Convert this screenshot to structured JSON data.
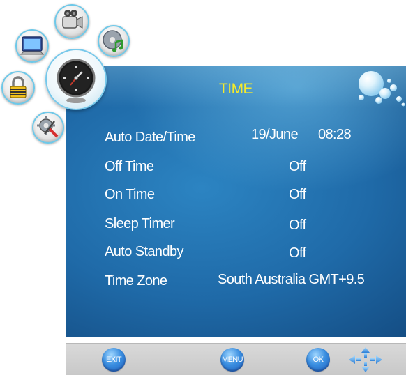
{
  "menu": {
    "title": "TIME",
    "categories": [
      {
        "id": "picture",
        "icon": "monitor-icon"
      },
      {
        "id": "video",
        "icon": "camcorder-icon"
      },
      {
        "id": "audio",
        "icon": "music-disc-icon"
      },
      {
        "id": "lock",
        "icon": "padlock-icon"
      },
      {
        "id": "time",
        "icon": "clock-icon",
        "selected": true
      },
      {
        "id": "setup",
        "icon": "tools-gear-icon"
      }
    ],
    "items": [
      {
        "label": "Auto Date/Time",
        "value_date": "19/June",
        "value_time": "08:28"
      },
      {
        "label": "Off Time",
        "value": "Off"
      },
      {
        "label": "On Time",
        "value": "Off"
      },
      {
        "label": "Sleep Timer",
        "value": "Off"
      },
      {
        "label": "Auto Standby",
        "value": "Off"
      },
      {
        "label": "Time Zone",
        "value": "South Australia GMT+9.5"
      }
    ]
  },
  "bottom_bar": {
    "exit_label": "EXIT",
    "menu_label": "MENU",
    "ok_label": "OK",
    "nav_icon": "directional-arrows-icon"
  },
  "colors": {
    "title": "#f4ea2c",
    "panel": "#1f6aa8",
    "text": "#ffffff",
    "bar": "#d0d0d0",
    "button": "#3a8ee0"
  }
}
